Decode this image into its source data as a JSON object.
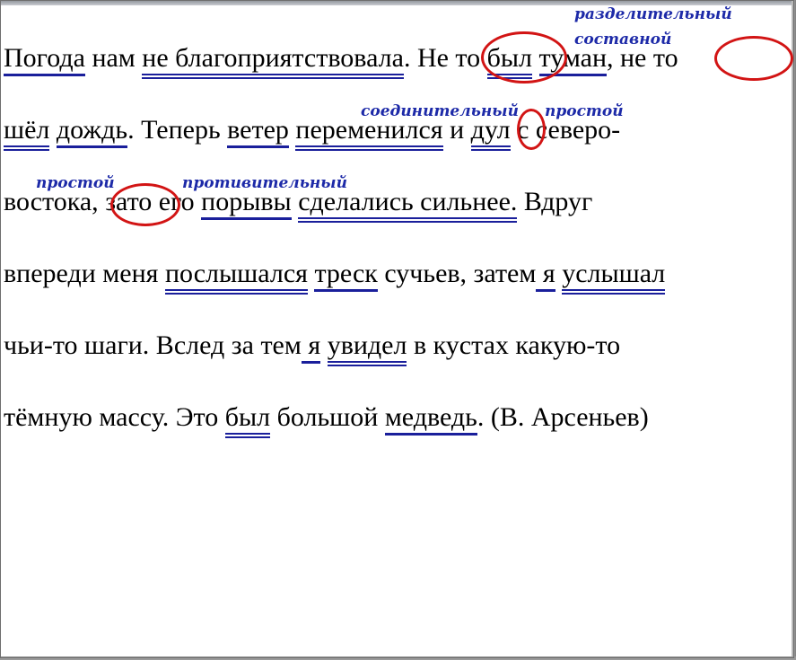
{
  "annotations": {
    "razdelitelny": "разделительный",
    "sostavnoy": "составной",
    "soedinitelny": "соединительный",
    "prostoy1": "простой",
    "prostoy2": "простой",
    "protivitelny": "противительный"
  },
  "text": {
    "l1": [
      "Погода",
      " нам ",
      "не благоприятствовала",
      ".",
      " Не то ",
      "был",
      " ",
      "туман",
      ", ",
      "не то"
    ],
    "l2": [
      "шёл",
      " ",
      "дождь",
      ". Теперь ",
      "ветер",
      " ",
      "переменился",
      " и ",
      "дул",
      " с северо-"
    ],
    "l3": [
      "востока, ",
      "зато",
      " его ",
      "порывы",
      " ",
      "сделались сильнее.",
      " Вдруг"
    ],
    "l4": [
      "впереди меня ",
      "послышался",
      " ",
      "треск",
      " сучьев, затем",
      " я",
      " ",
      "услышал"
    ],
    "l5": [
      "чьи-то шаги. Вслед за тем",
      " я",
      " ",
      "увидел",
      " в кустах какую-то"
    ],
    "l6": [
      "тёмную массу. Это ",
      "был",
      " большой ",
      "медведь",
      ". (В. Арсеньев)"
    ]
  },
  "colors": {
    "underline": "#1a1f9b",
    "annotation": "#1d2aa8",
    "circle": "#d21414"
  }
}
